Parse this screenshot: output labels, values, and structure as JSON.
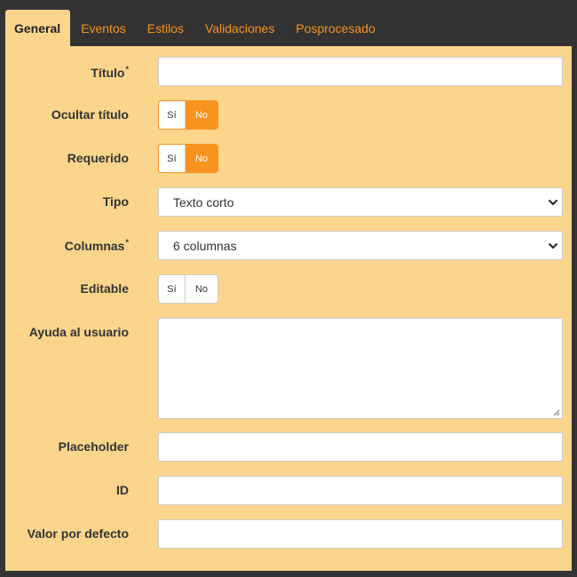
{
  "tabs": [
    {
      "label": "General",
      "active": true
    },
    {
      "label": "Eventos",
      "active": false
    },
    {
      "label": "Estilos",
      "active": false
    },
    {
      "label": "Validaciones",
      "active": false
    },
    {
      "label": "Posprocesado",
      "active": false
    }
  ],
  "form": {
    "titulo": {
      "label": "Título",
      "required_mark": "*",
      "value": ""
    },
    "ocultar_titulo": {
      "label": "Ocultar título",
      "yes": "Sí",
      "no": "No",
      "selected": "No"
    },
    "requerido": {
      "label": "Requerido",
      "yes": "Sí",
      "no": "No",
      "selected": "No"
    },
    "tipo": {
      "label": "Tipo",
      "value": "Texto corto"
    },
    "columnas": {
      "label": "Columnas",
      "required_mark": "*",
      "value": "6 columnas"
    },
    "editable": {
      "label": "Editable",
      "yes": "Sí",
      "no": "No",
      "selected": ""
    },
    "ayuda": {
      "label": "Ayuda al usuario",
      "value": ""
    },
    "placeholder": {
      "label": "Placeholder",
      "value": ""
    },
    "id": {
      "label": "ID",
      "value": ""
    },
    "valor_defecto": {
      "label": "Valor por defecto",
      "value": ""
    }
  },
  "colors": {
    "accent": "#f7931e",
    "panel_bg": "#fbd58c",
    "page_bg": "#333333"
  }
}
